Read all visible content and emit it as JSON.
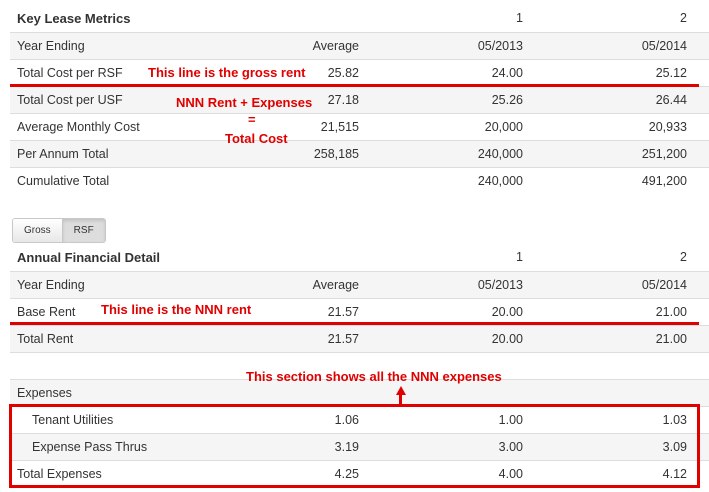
{
  "lease_metrics": {
    "title": "Key Lease Metrics",
    "col1": "1",
    "col2": "2",
    "rows": [
      {
        "label": "Year Ending",
        "average": "Average",
        "v1": "05/2013",
        "v2": "05/2014"
      },
      {
        "label": "Total Cost per RSF",
        "average": "25.82",
        "v1": "24.00",
        "v2": "25.12"
      },
      {
        "label": "Total Cost per USF",
        "average": "27.18",
        "v1": "25.26",
        "v2": "26.44"
      },
      {
        "label": "Average Monthly Cost",
        "average": "21,515",
        "v1": "20,000",
        "v2": "20,933"
      },
      {
        "label": "Per Annum Total",
        "average": "258,185",
        "v1": "240,000",
        "v2": "251,200"
      },
      {
        "label": "Cumulative Total",
        "average": "",
        "v1": "240,000",
        "v2": "491,200"
      }
    ]
  },
  "toggle": {
    "gross_label": "Gross",
    "rsf_label": "RSF",
    "active": "RSF"
  },
  "financial_detail": {
    "title": "Annual Financial Detail",
    "col1": "1",
    "col2": "2",
    "rows": [
      {
        "label": "Year Ending",
        "average": "Average",
        "v1": "05/2013",
        "v2": "05/2014"
      },
      {
        "label": "Base Rent",
        "average": "21.57",
        "v1": "20.00",
        "v2": "21.00"
      },
      {
        "label": "Total Rent",
        "average": "21.57",
        "v1": "20.00",
        "v2": "21.00"
      },
      {
        "label": "",
        "average": "",
        "v1": "",
        "v2": ""
      },
      {
        "label": "Expenses",
        "average": "",
        "v1": "",
        "v2": ""
      },
      {
        "label": "Tenant Utilities",
        "average": "1.06",
        "v1": "1.00",
        "v2": "1.03"
      },
      {
        "label": "Expense Pass Thrus",
        "average": "3.19",
        "v1": "3.00",
        "v2": "3.09"
      },
      {
        "label": "Total Expenses",
        "average": "4.25",
        "v1": "4.00",
        "v2": "4.12"
      }
    ]
  },
  "annotations": {
    "gross_rent_note": "This line is the gross rent",
    "total_cost_note_line1": "NNN Rent + Expenses",
    "total_cost_note_line2": "=",
    "total_cost_note_line3": "Total Cost",
    "nnn_rent_note": "This line is the NNN rent",
    "expenses_note": "This section shows all the NNN expenses"
  },
  "colors": {
    "annotation": "#e00000",
    "row_shade": "#f5f5f5",
    "border": "#dddddd"
  }
}
